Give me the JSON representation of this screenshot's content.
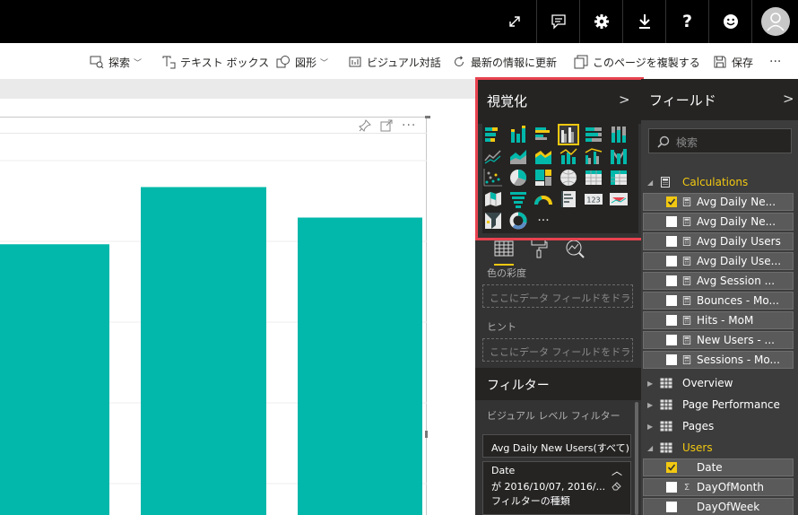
{
  "topbar": {
    "buttons": [
      {
        "name": "expand",
        "icon": "expand-icon"
      },
      {
        "name": "comment",
        "icon": "comment-icon"
      },
      {
        "name": "settings",
        "icon": "gear-icon"
      },
      {
        "name": "download",
        "icon": "download-icon"
      },
      {
        "name": "help",
        "icon": "help-icon",
        "label": "?"
      },
      {
        "name": "feedback",
        "icon": "smiley-icon"
      },
      {
        "name": "account",
        "icon": "avatar-icon"
      }
    ]
  },
  "ribbon": {
    "explore": "探索",
    "textbox": "テキスト ボックス",
    "shapes": "図形",
    "visual_interactions": "ビジュアル対話",
    "refresh": "最新の情報に更新",
    "duplicate": "このページを複製する",
    "save": "保存",
    "more": "···"
  },
  "visualizations": {
    "title": "視覚化",
    "chevron": ">",
    "more": "···",
    "selected_index": 3
  },
  "wells": {
    "color_saturation_label": "色の彩度",
    "color_saturation_placeholder": "ここにデータ フィールドをドラッグします",
    "tooltip_label": "ヒント",
    "tooltip_placeholder": "ここにデータ フィールドをドラッグします"
  },
  "filters": {
    "title": "フィルター",
    "visual_level_label": "ビジュアル レベル フィルター",
    "card1": "Avg Daily New Users(すべて)",
    "card2_title": "Date",
    "card2_value": "が 2016/10/07, 2016/...",
    "card2_type": "フィルターの種類"
  },
  "fields": {
    "title": "フィールド",
    "chevron": ">",
    "search_placeholder": "検索",
    "tables": [
      {
        "name": "Calculations",
        "highlighted": true,
        "expanded": true,
        "fields": [
          {
            "label": "Avg Daily Ne...",
            "checked": true
          },
          {
            "label": "Avg Daily Ne...",
            "checked": false
          },
          {
            "label": "Avg Daily Users",
            "checked": false
          },
          {
            "label": "Avg Daily Use...",
            "checked": false
          },
          {
            "label": "Avg Session ...",
            "checked": false
          },
          {
            "label": "Bounces - Mo...",
            "checked": false
          },
          {
            "label": "Hits - MoM",
            "checked": false
          },
          {
            "label": "New Users - ...",
            "checked": false
          },
          {
            "label": "Sessions - Mo...",
            "checked": false
          }
        ]
      },
      {
        "name": "Overview",
        "highlighted": false,
        "expanded": false
      },
      {
        "name": "Page Performance",
        "highlighted": false,
        "expanded": false
      },
      {
        "name": "Pages",
        "highlighted": false,
        "expanded": false
      },
      {
        "name": "Users",
        "highlighted": true,
        "expanded": true,
        "fields": [
          {
            "label": "Date",
            "checked": true,
            "type": "calendar"
          },
          {
            "label": "DayOfMonth",
            "checked": false,
            "type": "sigma"
          },
          {
            "label": "DayOfWeek",
            "checked": false,
            "type": "text"
          }
        ]
      }
    ]
  },
  "chart_data": {
    "type": "bar",
    "title": "",
    "categories": [
      "",
      "",
      ""
    ],
    "values": [
      0.71,
      0.86,
      0.78
    ],
    "value_units": "fraction of visible plot height",
    "color": "#01b8aa",
    "grid": true
  },
  "colors": {
    "accent": "#f2c811",
    "bar": "#01b8aa",
    "highlight": "#e8424f",
    "panel_dark": "#252423",
    "panel": "#333333"
  }
}
